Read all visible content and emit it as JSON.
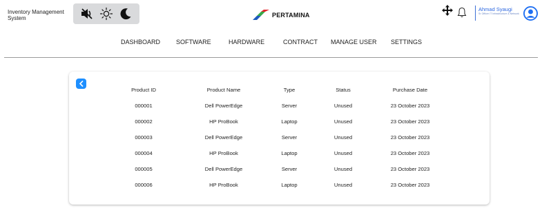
{
  "app": {
    "title": "Inventory Management System",
    "brand": "PERTAMINA"
  },
  "toolbar": {
    "mute_icon": "speaker-mute-icon",
    "light_icon": "sun-icon",
    "dark_icon": "moon-icon"
  },
  "user": {
    "name": "Ahmad Syaugi",
    "role": "Sr Officer IT Infrastructure & Network"
  },
  "nav": [
    {
      "label": "DASHBOARD"
    },
    {
      "label": "SOFTWARE"
    },
    {
      "label": "HARDWARE"
    },
    {
      "label": "CONTRACT"
    },
    {
      "label": "MANAGE USER"
    },
    {
      "label": "SETTINGS"
    }
  ],
  "table": {
    "headers": [
      "Product ID",
      "Product Name",
      "Type",
      "Status",
      "Purchase Date"
    ],
    "rows": [
      [
        "000001",
        "Dell PowerEdge",
        "Server",
        "Unused",
        "23 October 2023"
      ],
      [
        "000002",
        "HP ProBook",
        "Laptop",
        "Unused",
        "23 October 2023"
      ],
      [
        "000003",
        "Dell PowerEdge",
        "Server",
        "Unused",
        "23 October 2023"
      ],
      [
        "000004",
        "HP ProBook",
        "Laptop",
        "Unused",
        "23 October 2023"
      ],
      [
        "000005",
        "Dell PowerEdge",
        "Server",
        "Unused",
        "23 October 2023"
      ],
      [
        "000006",
        "HP ProBook",
        "Laptop",
        "Unused",
        "23 October 2023"
      ]
    ]
  },
  "colors": {
    "accent": "#1e8fff",
    "user_blue": "#2c67e0",
    "toggle_bg": "#d9dadc"
  }
}
